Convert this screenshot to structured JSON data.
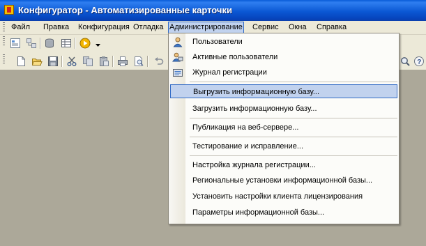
{
  "window": {
    "title": "Конфигуратор - Автоматизированные карточки"
  },
  "menubar": {
    "items": [
      {
        "label": "Файл"
      },
      {
        "label": "Правка"
      },
      {
        "label": "Конфигурация"
      },
      {
        "label": "Отладка"
      },
      {
        "label": "Администрирование"
      },
      {
        "label": "Сервис"
      },
      {
        "label": "Окна"
      },
      {
        "label": "Справка"
      }
    ]
  },
  "toolbar": {
    "row1_icons": [
      "config-window-icon",
      "config-tree-icon",
      "database-icon",
      "grid-icon",
      "run-icon",
      "dropdown-arrow-icon"
    ],
    "row2_icons": [
      "new-file-icon",
      "open-folder-icon",
      "save-icon",
      "cut-icon",
      "copy-icon",
      "paste-icon",
      "print-icon",
      "print-preview-icon",
      "undo-icon",
      "search-icon",
      "help-icon"
    ]
  },
  "admin_menu": {
    "items": [
      {
        "label": "Пользователи",
        "icon": "user-icon"
      },
      {
        "label": "Активные пользователи",
        "icon": "active-users-icon"
      },
      {
        "label": "Журнал регистрации",
        "icon": "log-icon"
      },
      {
        "label": "Выгрузить информационную базу..."
      },
      {
        "label": "Загрузить информационную базу..."
      },
      {
        "label": "Публикация на веб-сервере..."
      },
      {
        "label": "Тестирование и исправление..."
      },
      {
        "label": "Настройка журнала регистрации..."
      },
      {
        "label": "Региональные установки информационной базы..."
      },
      {
        "label": "Установить настройки клиента лицензирования"
      },
      {
        "label": "Параметры информационной базы..."
      }
    ],
    "highlighted": "Выгрузить информационную базу..."
  },
  "colors": {
    "titlebar": "#0a5cd8",
    "highlight": "#c1d2ee",
    "highlight_border": "#316ac5",
    "workspace": "#aca899"
  }
}
